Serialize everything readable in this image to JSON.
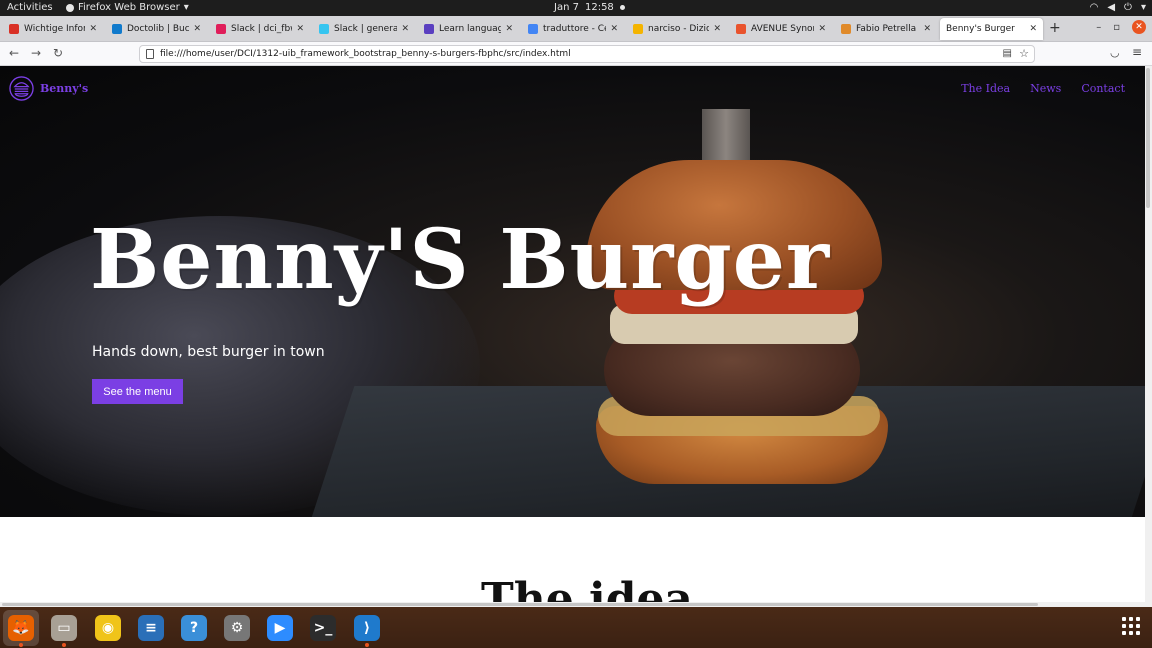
{
  "system_bar": {
    "activities": "Activities",
    "app_name": "Firefox Web Browser",
    "date": "Jan 7",
    "time": "12:58"
  },
  "tabs": [
    {
      "title": "Wichtige Informa",
      "favicon_color": "#d93025"
    },
    {
      "title": "Doctolib | Bucher",
      "favicon_color": "#107acc"
    },
    {
      "title": "Slack | dci_fbw_w",
      "favicon_color": "#e01e5a"
    },
    {
      "title": "Slack | general | K",
      "favicon_color": "#36c5f0"
    },
    {
      "title": "Learn languages",
      "favicon_color": "#5a3fc0"
    },
    {
      "title": "traduttore - Cerca",
      "favicon_color": "#4285f4"
    },
    {
      "title": "narciso - Dizionar",
      "favicon_color": "#f4b400"
    },
    {
      "title": "AVENUE Synonym",
      "favicon_color": "#e9532d"
    },
    {
      "title": "Fabio Petrella | C",
      "favicon_color": "#e08a2a"
    },
    {
      "title": "Benny's Burger",
      "favicon_color": "#ffffff",
      "active": true
    }
  ],
  "url": "file:///home/user/DCI/1312-uib_framework_bootstrap_benny-s-burgers-fbphc/src/index.html",
  "site": {
    "brand": "Benny's",
    "nav_links": [
      "The Idea",
      "News",
      "Contact"
    ],
    "hero_title": "Benny'S Burger",
    "hero_subtitle": "Hands down, best burger in town",
    "hero_button": "See the menu",
    "section_heading": "The idea",
    "accent_color": "#7b3fe4"
  },
  "dock": {
    "apps": [
      {
        "name": "firefox",
        "color": "#e66000",
        "glyph": "🦊",
        "running": true,
        "active": true
      },
      {
        "name": "files",
        "color": "#a8a095",
        "glyph": "▭",
        "running": true
      },
      {
        "name": "rhythmbox",
        "color": "#f0c419",
        "glyph": "◉",
        "running": false
      },
      {
        "name": "libreoffice-writer",
        "color": "#2a6fb8",
        "glyph": "≡",
        "running": false
      },
      {
        "name": "help",
        "color": "#3a8fd8",
        "glyph": "?",
        "running": false
      },
      {
        "name": "settings",
        "color": "#777777",
        "glyph": "⚙",
        "running": false
      },
      {
        "name": "zoom",
        "color": "#2d8cff",
        "glyph": "▶",
        "running": false
      },
      {
        "name": "terminal",
        "color": "#2c2c2c",
        "glyph": ">_",
        "running": false
      },
      {
        "name": "vscode",
        "color": "#1f7acc",
        "glyph": "⟩",
        "running": true
      }
    ]
  }
}
